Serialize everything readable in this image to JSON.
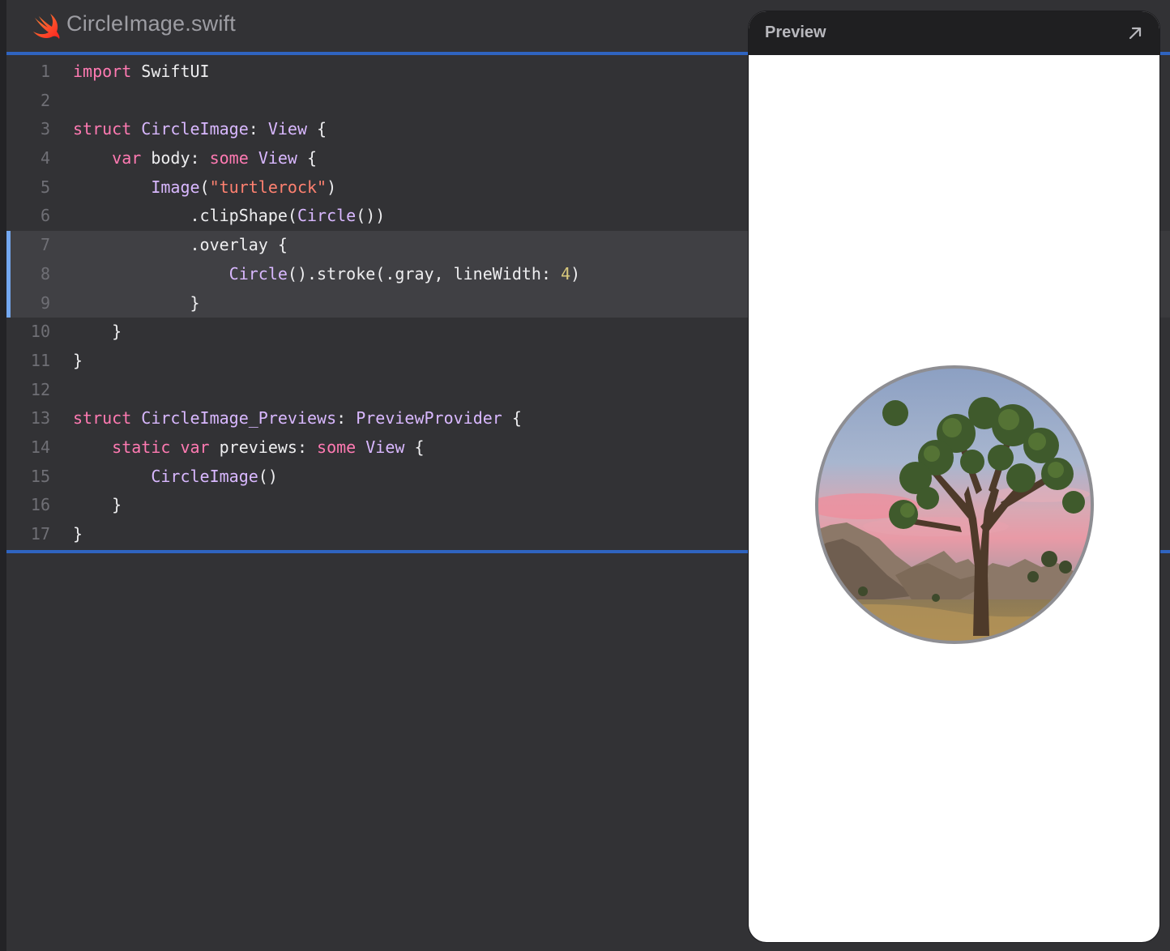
{
  "file": {
    "icon": "swift-logo-icon",
    "title": "CircleImage.swift"
  },
  "colors": {
    "keyword": "#ff7ab2",
    "type": "#d9b8ff",
    "string": "#ff8170",
    "number": "#d9c97c",
    "plain": "#eeeef0",
    "line_number": "#6f6f75",
    "accent_rule": "#2f64c0",
    "highlight_bar": "#74a8f0",
    "editor_bg": "#323235"
  },
  "editor": {
    "highlighted_lines": [
      7,
      8,
      9
    ],
    "lines": [
      {
        "n": "1",
        "tokens": [
          {
            "t": "import",
            "k": "kw"
          },
          {
            "t": " SwiftUI",
            "k": "pl"
          }
        ]
      },
      {
        "n": "2",
        "tokens": []
      },
      {
        "n": "3",
        "tokens": [
          {
            "t": "struct ",
            "k": "kw"
          },
          {
            "t": "CircleImage",
            "k": "ty"
          },
          {
            "t": ": ",
            "k": "pl"
          },
          {
            "t": "View",
            "k": "ty"
          },
          {
            "t": " {",
            "k": "pl"
          }
        ]
      },
      {
        "n": "4",
        "tokens": [
          {
            "t": "    ",
            "k": "pl"
          },
          {
            "t": "var",
            "k": "kw"
          },
          {
            "t": " body: ",
            "k": "pl"
          },
          {
            "t": "some",
            "k": "kw"
          },
          {
            "t": " ",
            "k": "pl"
          },
          {
            "t": "View",
            "k": "ty"
          },
          {
            "t": " {",
            "k": "pl"
          }
        ]
      },
      {
        "n": "5",
        "tokens": [
          {
            "t": "        ",
            "k": "pl"
          },
          {
            "t": "Image",
            "k": "ty"
          },
          {
            "t": "(",
            "k": "pl"
          },
          {
            "t": "\"turtlerock\"",
            "k": "str"
          },
          {
            "t": ")",
            "k": "pl"
          }
        ]
      },
      {
        "n": "6",
        "tokens": [
          {
            "t": "            .clipShape(",
            "k": "pl"
          },
          {
            "t": "Circle",
            "k": "ty"
          },
          {
            "t": "())",
            "k": "pl"
          }
        ]
      },
      {
        "n": "7",
        "tokens": [
          {
            "t": "            .overlay {",
            "k": "pl"
          }
        ]
      },
      {
        "n": "8",
        "tokens": [
          {
            "t": "                ",
            "k": "pl"
          },
          {
            "t": "Circle",
            "k": "ty"
          },
          {
            "t": "().stroke(.gray, lineWidth: ",
            "k": "pl"
          },
          {
            "t": "4",
            "k": "num"
          },
          {
            "t": ")",
            "k": "pl"
          }
        ]
      },
      {
        "n": "9",
        "tokens": [
          {
            "t": "            }",
            "k": "pl"
          }
        ]
      },
      {
        "n": "10",
        "tokens": [
          {
            "t": "    }",
            "k": "pl"
          }
        ]
      },
      {
        "n": "11",
        "tokens": [
          {
            "t": "}",
            "k": "pl"
          }
        ]
      },
      {
        "n": "12",
        "tokens": []
      },
      {
        "n": "13",
        "tokens": [
          {
            "t": "struct ",
            "k": "kw"
          },
          {
            "t": "CircleImage_Previews",
            "k": "ty"
          },
          {
            "t": ": ",
            "k": "pl"
          },
          {
            "t": "PreviewProvider",
            "k": "ty"
          },
          {
            "t": " {",
            "k": "pl"
          }
        ]
      },
      {
        "n": "14",
        "tokens": [
          {
            "t": "    ",
            "k": "pl"
          },
          {
            "t": "static",
            "k": "kw"
          },
          {
            "t": " ",
            "k": "pl"
          },
          {
            "t": "var",
            "k": "kw"
          },
          {
            "t": " previews: ",
            "k": "pl"
          },
          {
            "t": "some",
            "k": "kw"
          },
          {
            "t": " ",
            "k": "pl"
          },
          {
            "t": "View",
            "k": "ty"
          },
          {
            "t": " {",
            "k": "pl"
          }
        ]
      },
      {
        "n": "15",
        "tokens": [
          {
            "t": "        ",
            "k": "pl"
          },
          {
            "t": "CircleImage",
            "k": "ty"
          },
          {
            "t": "()",
            "k": "pl"
          }
        ]
      },
      {
        "n": "16",
        "tokens": [
          {
            "t": "    }",
            "k": "pl"
          }
        ]
      },
      {
        "n": "17",
        "tokens": [
          {
            "t": "}",
            "k": "pl"
          }
        ]
      }
    ]
  },
  "preview": {
    "title": "Preview",
    "expand_icon": "expand-arrow-icon",
    "image_name": "turtlerock",
    "image_shape": "circle",
    "image_stroke": "gray"
  }
}
